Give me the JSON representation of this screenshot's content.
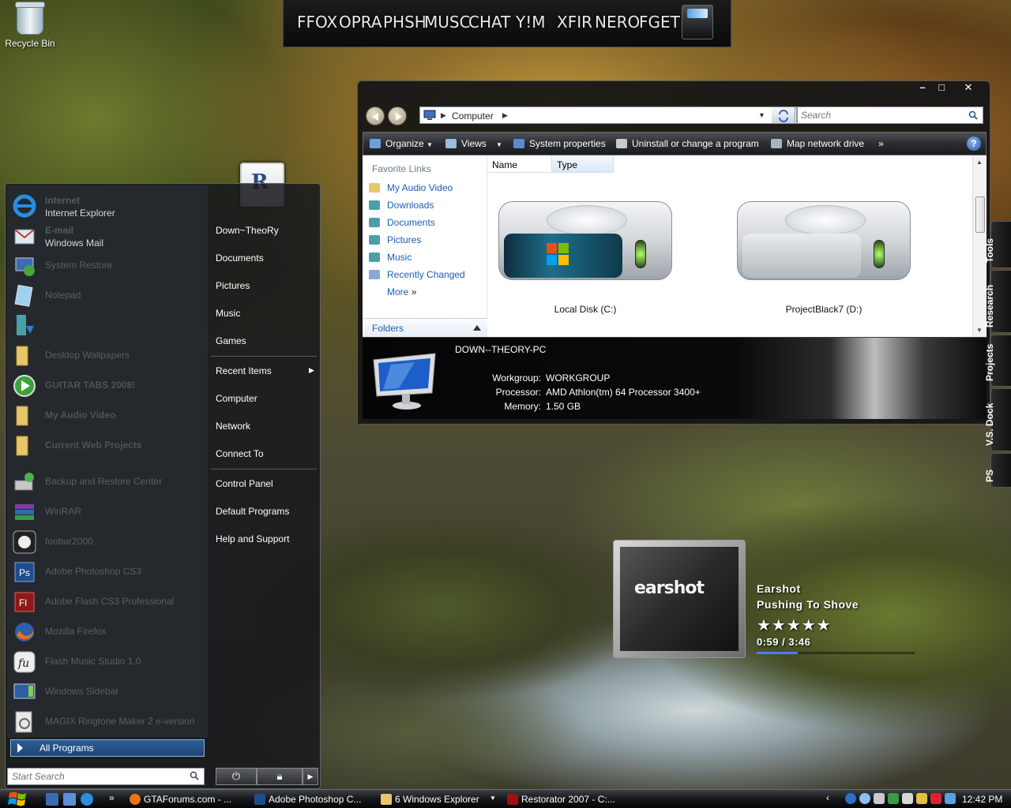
{
  "desktop": {
    "recycle_bin_label": "Recycle Bin"
  },
  "top_dock": {
    "items": [
      "FFOX",
      "OPRA",
      "PHSH",
      "MUSC",
      "CHAT",
      "Y!M",
      "XFIR",
      "NERO",
      "FGET"
    ]
  },
  "start_menu": {
    "pinned": [
      {
        "title": "Internet",
        "subtitle": "Internet Explorer",
        "icon": "internet-explorer-icon"
      },
      {
        "title": "E-mail",
        "subtitle": "Windows Mail",
        "icon": "windows-mail-icon"
      }
    ],
    "programs": [
      {
        "label": "System Restore",
        "icon": "system-restore-icon"
      },
      {
        "label": "Notepad",
        "icon": "notepad-icon"
      },
      {
        "label": "",
        "icon": "download-icon"
      },
      {
        "label": "Desktop Wallpapers",
        "icon": "folder-icon"
      },
      {
        "label": "GUITAR TABS 2008!",
        "icon": "play-icon"
      },
      {
        "label": "My Audio Video",
        "icon": "folder-icon"
      },
      {
        "label": "Current Web Projects",
        "icon": "folder-icon"
      },
      {
        "label": "Backup and Restore Center",
        "icon": "backup-icon"
      },
      {
        "label": "WinRAR",
        "icon": "winrar-icon"
      },
      {
        "label": "foobar2000",
        "icon": "foobar-icon"
      },
      {
        "label": "Adobe Photoshop CS3",
        "icon": "photoshop-icon"
      },
      {
        "label": "Adobe Flash CS3 Professional",
        "icon": "flash-icon"
      },
      {
        "label": "Mozilla Firefox",
        "icon": "firefox-icon"
      },
      {
        "label": "Flash Music Studio 1.0",
        "icon": "flash-music-icon"
      },
      {
        "label": "Windows Sidebar",
        "icon": "sidebar-icon"
      },
      {
        "label": "MAGIX Ringtone Maker 2 e-version",
        "icon": "magix-icon"
      }
    ],
    "all_programs_label": "All Programs",
    "search_placeholder": "Start Search",
    "right_links": {
      "user": "Down~TheoRy",
      "documents": "Documents",
      "pictures": "Pictures",
      "music": "Music",
      "games": "Games",
      "recent_items": "Recent Items",
      "computer": "Computer",
      "network": "Network",
      "connect_to": "Connect To",
      "control_panel": "Control Panel",
      "default_programs": "Default Programs",
      "help_support": "Help and Support"
    }
  },
  "explorer": {
    "address_location": "Computer",
    "search_placeholder": "Search",
    "toolbar": {
      "organize": "Organize",
      "views": "Views",
      "system_properties": "System properties",
      "uninstall": "Uninstall or change a program",
      "map_drive": "Map network drive"
    },
    "nav_pane": {
      "header": "Favorite Links",
      "links": [
        "My Audio Video",
        "Downloads",
        "Documents",
        "Pictures",
        "Music",
        "Recently Changed"
      ],
      "more": "More",
      "folders": "Folders"
    },
    "columns": [
      "Name",
      "Type"
    ],
    "drives": [
      {
        "label": "Local Disk (C:)"
      },
      {
        "label": "ProjectBlack7 (D:)"
      }
    ],
    "details": {
      "pc_name": "DOWN--THEORY-PC",
      "workgroup_key": "Workgroup:",
      "workgroup": "WORKGROUP",
      "processor_key": "Processor:",
      "processor": "AMD Athlon(tm) 64 Processor 3400+",
      "memory_key": "Memory:",
      "memory": "1.50 GB"
    }
  },
  "side_tabs": [
    "Tools",
    "Research",
    "Projects",
    "V.S. Dock",
    "PS"
  ],
  "media_player": {
    "artist": "Earshot",
    "track": "Pushing To Shove",
    "rating_stars": 5,
    "stars_text": "★★★★★",
    "time": "0:59 / 3:46",
    "progress": 0.26,
    "cover_text": "earshot"
  },
  "taskbar": {
    "buttons": [
      {
        "label": "GTAForums.com - ...",
        "icon": "firefox-icon"
      },
      {
        "label": "Adobe Photoshop C...",
        "icon": "photoshop-icon"
      },
      {
        "label": "6 Windows Explorer",
        "icon": "folder-icon"
      },
      {
        "label": "Restorator 2007 - C:...",
        "icon": "restorator-icon"
      }
    ],
    "clock": "12:42 PM"
  }
}
